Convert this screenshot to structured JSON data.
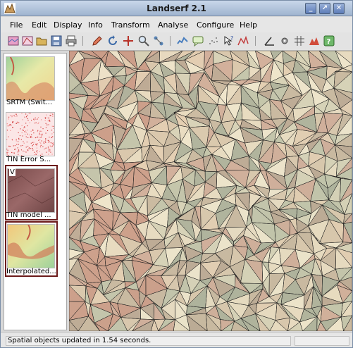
{
  "window": {
    "title": "Landserf 2.1",
    "controls": [
      "minimize-icon",
      "maximize-icon",
      "close-icon"
    ]
  },
  "menu": {
    "items": [
      {
        "label": "File"
      },
      {
        "label": "Edit"
      },
      {
        "label": "Display"
      },
      {
        "label": "Info"
      },
      {
        "label": "Transform"
      },
      {
        "label": "Analyse"
      },
      {
        "label": "Configure"
      },
      {
        "label": "Help"
      }
    ]
  },
  "toolbar": {
    "icons": [
      "open-raster-icon",
      "open-vector-icon",
      "open-folder-icon",
      "save-icon",
      "print-icon",
      "edit-pencil-icon",
      "rotate-icon",
      "pan-icon",
      "zoom-icon",
      "select-icon",
      "profile-icon",
      "query-icon",
      "scatter-icon",
      "query-point-icon",
      "graph-icon",
      "angle-icon",
      "settings-icon",
      "grid-icon",
      "terrain-icon",
      "help-icon"
    ]
  },
  "sidebar": {
    "items": [
      {
        "label": "SRTM (Swit...",
        "selected": false
      },
      {
        "label": "TIN Error S...",
        "selected": false
      },
      {
        "label": "TIN model ...",
        "selected": true,
        "badge": "V"
      },
      {
        "label": "Interpolated...",
        "selected": true
      }
    ]
  },
  "status": {
    "message": "Spatial objects updated in 1.54 seconds."
  },
  "colors": {
    "titlebar": "#9fb4cf",
    "selection": "#6b1a1a",
    "terrain_light": "#efe4c6",
    "terrain_shadow": "#8a8e80",
    "terrain_red": "#c9907b"
  }
}
